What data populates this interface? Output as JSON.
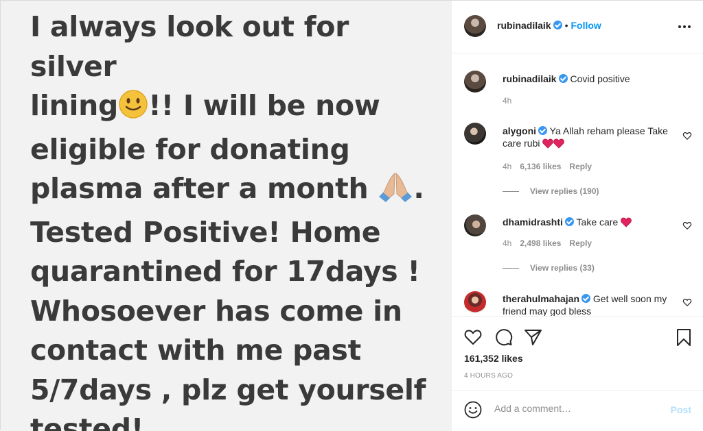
{
  "media": {
    "line1": "I always look out for silver",
    "line2a": "lining",
    "line2b": "!! I will be now",
    "line3": "eligible for donating",
    "line4a": "plasma after a month",
    "line4b": ".",
    "line5": "Tested Positive! Home",
    "line6": "quarantined for 17days !",
    "line7": "Whosoever has come in",
    "line8": "contact with me past",
    "line9": "5/7days , plz get yourself",
    "line10": "tested!"
  },
  "header": {
    "username": "rubinadilaik",
    "separator": "•",
    "follow_label": "Follow"
  },
  "comments": [
    {
      "username": "rubinadilaik",
      "text": "Covid positive",
      "time": "4h"
    },
    {
      "username": "alygoni",
      "text": "Ya Allah reham please Take care rubi",
      "time": "4h",
      "likes": "6,136 likes",
      "reply": "Reply",
      "view_replies": "View replies (190)"
    },
    {
      "username": "dhamidrashti",
      "text": "Take care",
      "time": "4h",
      "likes": "2,498 likes",
      "reply": "Reply",
      "view_replies": "View replies (33)"
    },
    {
      "username": "therahulmahajan",
      "text": "Get well soon my friend may god bless"
    }
  ],
  "actions": {
    "likes": "161,352 likes",
    "time": "4 HOURS AGO"
  },
  "add_comment": {
    "placeholder": "Add a comment…",
    "post_label": "Post"
  },
  "colors": {
    "link": "#0095f6",
    "verified": "#3897f0",
    "muted": "#8e8e8e",
    "post_disabled": "#b2dffc"
  },
  "icons": [
    "verified-badge-icon",
    "more-options-icon",
    "heart-icon",
    "comment-icon",
    "share-icon",
    "bookmark-icon",
    "emoji-icon",
    "red-heart-icon",
    "slightly-smiling-emoji",
    "folded-hands-emoji"
  ]
}
